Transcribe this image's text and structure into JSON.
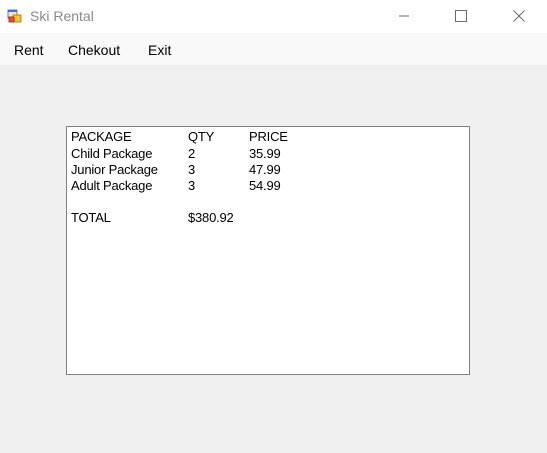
{
  "window": {
    "title": "Ski Rental",
    "icon": "winforms-app-icon",
    "controls": [
      "minimize-icon",
      "maximize-icon",
      "close-icon"
    ]
  },
  "menu": {
    "items": [
      {
        "label": "Rent"
      },
      {
        "label": "Chekout"
      },
      {
        "label": "Exit"
      }
    ]
  },
  "listbox": {
    "header": {
      "package": "PACKAGE",
      "qty": "QTY",
      "price": "PRICE"
    },
    "rows": [
      {
        "package": "Child Package",
        "qty": "2",
        "price": "35.99"
      },
      {
        "package": "Junior Package",
        "qty": "3",
        "price": "47.99"
      },
      {
        "package": "Adult Package",
        "qty": "3",
        "price": "54.99"
      }
    ],
    "total": {
      "label": "TOTAL",
      "value": "$380.92"
    }
  }
}
